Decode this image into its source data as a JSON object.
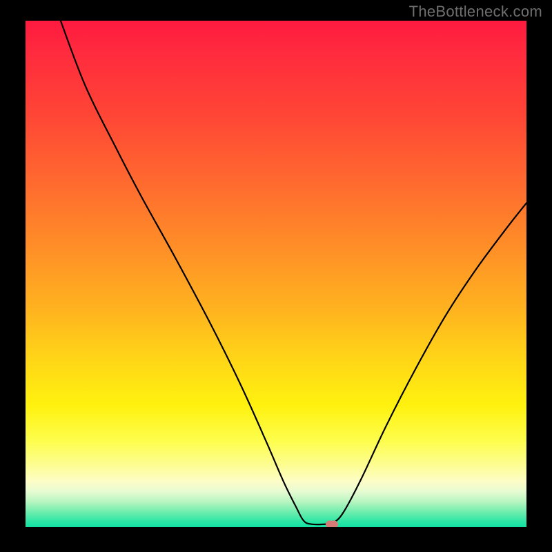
{
  "watermark": "TheBottleneck.com",
  "chart_data": {
    "type": "line",
    "title": "",
    "xlabel": "",
    "ylabel": "",
    "x_range_pct": [
      0,
      100
    ],
    "y_range_pct": [
      0,
      100
    ],
    "series": [
      {
        "name": "bottleneck-curve",
        "color": "#000000",
        "points_pct": [
          {
            "x": 7.0,
            "y": 100.0
          },
          {
            "x": 12.0,
            "y": 87.0
          },
          {
            "x": 18.0,
            "y": 75.0
          },
          {
            "x": 23.0,
            "y": 65.5
          },
          {
            "x": 30.0,
            "y": 53.0
          },
          {
            "x": 37.0,
            "y": 40.0
          },
          {
            "x": 43.0,
            "y": 28.0
          },
          {
            "x": 48.0,
            "y": 17.0
          },
          {
            "x": 51.5,
            "y": 9.0
          },
          {
            "x": 54.0,
            "y": 4.0
          },
          {
            "x": 55.5,
            "y": 1.3
          },
          {
            "x": 57.0,
            "y": 0.6
          },
          {
            "x": 60.0,
            "y": 0.6
          },
          {
            "x": 61.5,
            "y": 0.9
          },
          {
            "x": 63.5,
            "y": 3.0
          },
          {
            "x": 67.0,
            "y": 9.5
          },
          {
            "x": 72.0,
            "y": 20.0
          },
          {
            "x": 78.0,
            "y": 31.5
          },
          {
            "x": 84.0,
            "y": 42.0
          },
          {
            "x": 90.0,
            "y": 51.0
          },
          {
            "x": 96.0,
            "y": 59.0
          },
          {
            "x": 100.0,
            "y": 64.0
          }
        ]
      }
    ],
    "marker": {
      "name": "current-point",
      "color": "#d87a78",
      "x_pct": 61.2,
      "y_pct": 0.6
    }
  }
}
